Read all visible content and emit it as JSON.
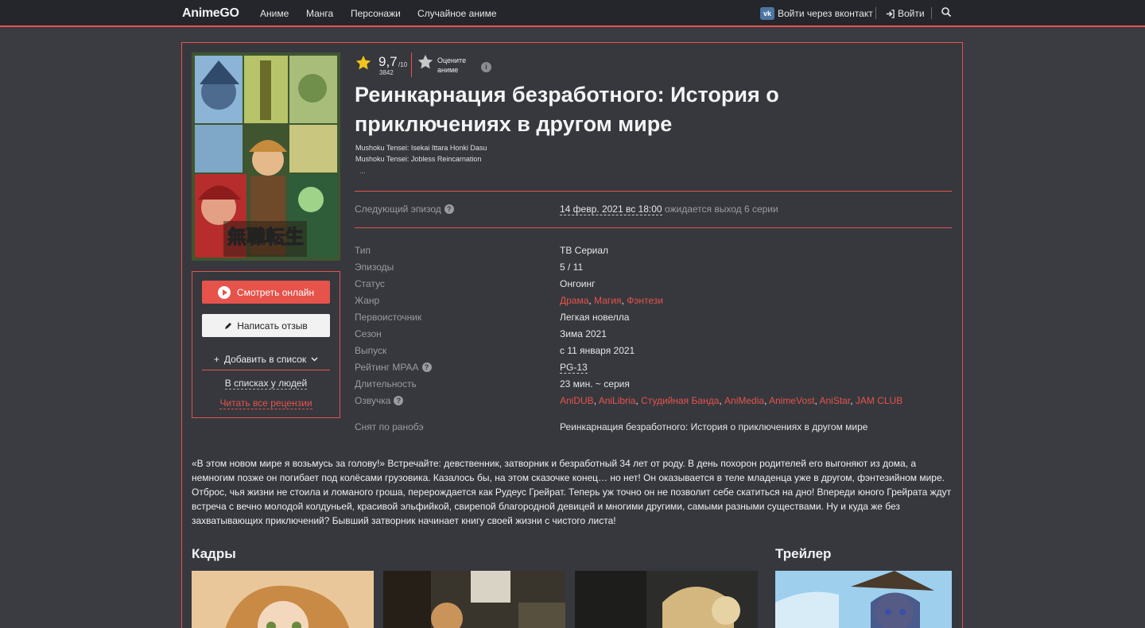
{
  "nav": {
    "brand": "AnimeGO",
    "links": [
      "Аниме",
      "Манга",
      "Персонажи",
      "Случайное аниме"
    ],
    "vk_icon": "vk",
    "vk_login": "Войти через вконтакт",
    "logout": "Войти"
  },
  "rating": {
    "value": "9,7",
    "scale": "/10",
    "count": "3842",
    "rate_label_1": "Оцените",
    "rate_label_2": "аниме",
    "info": "i"
  },
  "title": "Реинкарнация безработного: История о приключениях в другом мире",
  "alt_names": [
    "Mushoku Tensei: Isekai Ittara Honki Dasu",
    "Mushoku Tensei: Jobless Reincarnation"
  ],
  "alt_more": "...",
  "next_episode": {
    "label": "Следующий эпизод",
    "date": "14 февр. 2021 вс 18:00",
    "status": "ожидается выход 6 серии"
  },
  "info": {
    "type_k": "Тип",
    "type_v": "ТВ Сериал",
    "episodes_k": "Эпизоды",
    "episodes_v": "5 / 11",
    "status_k": "Статус",
    "status_v": "Онгоинг",
    "genre_k": "Жанр",
    "genres": [
      "Драма",
      "Магия",
      "Фэнтези"
    ],
    "source_k": "Первоисточник",
    "source_v": "Легкая новелла",
    "season_k": "Сезон",
    "season_v": "Зима 2021",
    "release_k": "Выпуск",
    "release_v": "с 11 января 2021",
    "mpaa_k": "Рейтинг MPAA",
    "mpaa_v": "PG-13",
    "duration_k": "Длительность",
    "duration_v": "23 мин. ~ серия",
    "dub_k": "Озвучка",
    "dubs": [
      "AniDUB",
      "AniLibria",
      "Студийная Банда",
      "AniMedia",
      "AnimeVost",
      "AniStar",
      "JAM CLUB"
    ],
    "based_k": "Снят по ранобэ",
    "based_v": "Реинкарнация безработного: История о приключениях в другом мире"
  },
  "actions": {
    "watch": "Смотреть онлайн",
    "review": "Написать отзыв",
    "add_list": "Добавить в список",
    "in_lists": "В списках у людей",
    "read_reviews": "Читать все рецензии"
  },
  "description": "«В этом новом мире я возьмусь за голову!» Встречайте: девственник, затворник и безработный 34 лет от роду. В день похорон родителей его выгоняют из дома, а немногим позже он погибает под колёсами грузовика. Казалось бы, на этом сказочке конец… но нет! Он оказывается в теле младенца уже в другом, фэнтезийном мире. Отброс, чья жизни не стоила и ломаного гроша, перерождается как Рудеус Грейрат. Теперь уж точно он не позволит себе скатиться на дно! Впереди юного Грейрата ждут встреча с вечно молодой колдуньей, красивой эльфийкой, свирепой благородной девицей и многими другими, самыми разными существами. Ну и куда же без захватывающих приключений? Бывший затворник начинает книгу своей жизни с чистого листа!",
  "sections": {
    "frames": "Кадры",
    "trailer": "Трейлер"
  },
  "poster_logo": "無職転生",
  "colors": {
    "accent": "#e5534b",
    "bg": "#3a3c42",
    "topbar": "#24262b",
    "star": "#f0c419"
  }
}
